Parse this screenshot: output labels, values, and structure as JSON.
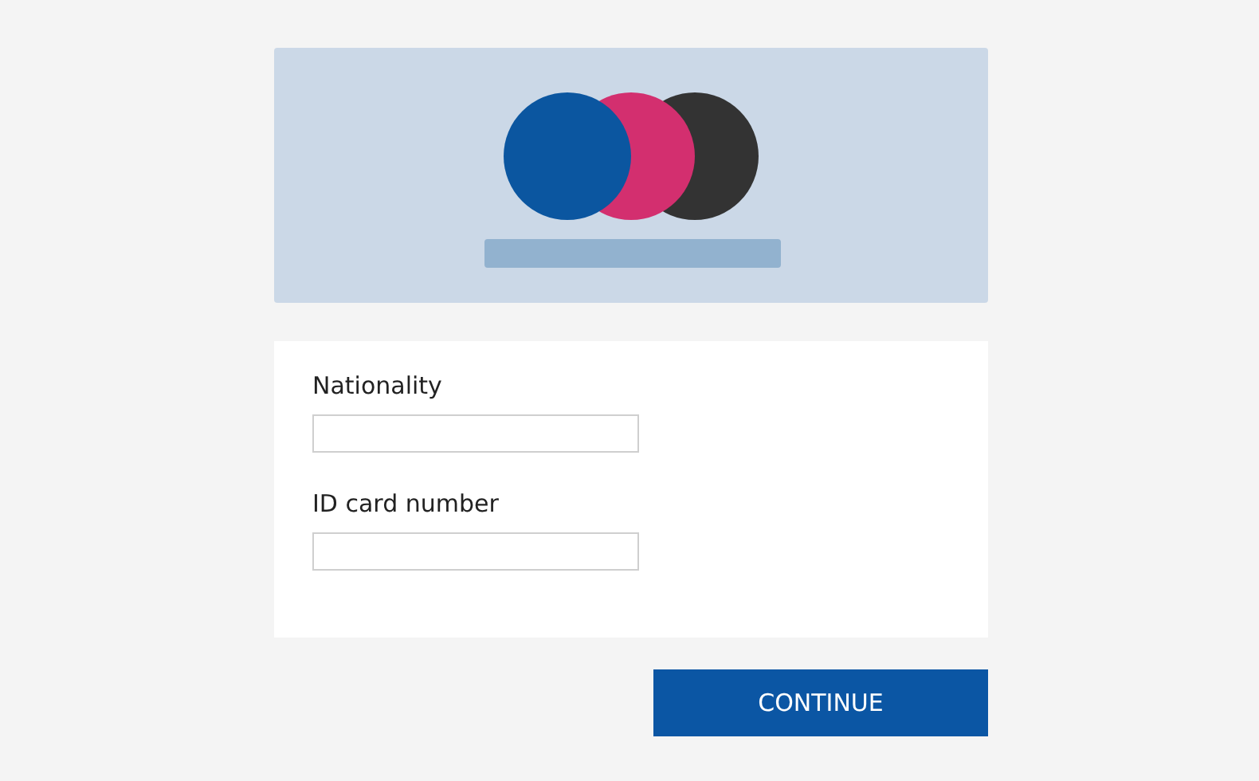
{
  "fields": [
    {
      "label": "Nationality"
    },
    {
      "label": "ID card number"
    }
  ],
  "button": {
    "label": "CONTINUE"
  }
}
